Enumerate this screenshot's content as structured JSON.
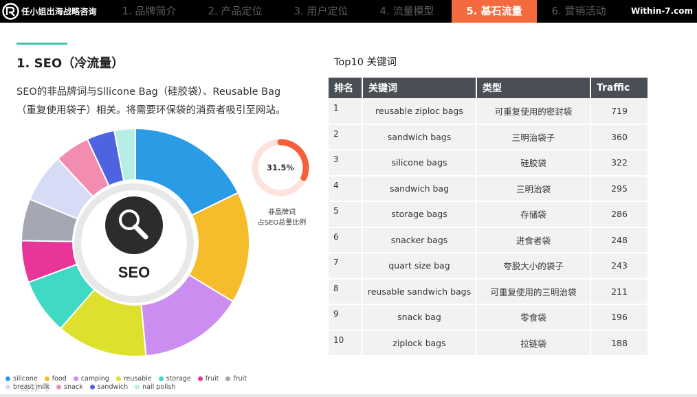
{
  "header": {
    "brand": "任小姐出海战略咨询",
    "site": "Within-7.com",
    "tabs": [
      {
        "label": "1. 品牌简介",
        "active": false
      },
      {
        "label": "2. 产品定位",
        "active": false
      },
      {
        "label": "3. 用户定位",
        "active": false
      },
      {
        "label": "4. 流量模型",
        "active": false
      },
      {
        "label": "5. 基石流量",
        "active": true
      },
      {
        "label": "6. 营销活动",
        "active": false
      }
    ]
  },
  "section": {
    "title": "1. SEO（冷流量）",
    "description": "SEO的非品牌词与Sllicone Bag（硅胶袋）、Reusable Bag（重复使用袋子）相关。将需要环保袋的消费者吸引至网站。"
  },
  "pie_center": {
    "label": "SEO",
    "icon": "search-icon"
  },
  "ring": {
    "value_label": "31.5%",
    "value": 31.5,
    "caption_line1": "非品牌词",
    "caption_line2": "占SEO总量比例",
    "color": "#f4603c",
    "track_color": "#fde3dc"
  },
  "chart_data": [
    {
      "type": "pie",
      "note_colors": [
        "#2b9be6",
        "#f5bc2c",
        "#cc8df0",
        "#dde12e",
        "#3fd9c4",
        "#e8359a",
        "#a5a8b2",
        "#d6dcf6",
        "#f38cb1",
        "#4d63e0",
        "#b6ede6"
      ],
      "values": [
        18,
        16,
        15,
        13,
        8,
        6,
        6,
        7,
        5,
        4,
        3
      ],
      "legend": [
        {
          "label": "silicone",
          "color": "#2b9be6"
        },
        {
          "label": "food",
          "color": "#f5bc2c"
        },
        {
          "label": "camping",
          "color": "#cc8df0"
        },
        {
          "label": "reusable",
          "color": "#dde12e"
        },
        {
          "label": "storage",
          "color": "#3fd9c4"
        },
        {
          "label": "fruit",
          "color": "#e8359a"
        },
        {
          "label": "fruit",
          "color": "#a5a8b2"
        },
        {
          "label": "breast milk",
          "color": "#d6dcf6"
        },
        {
          "label": "snack",
          "color": "#f38cb1"
        },
        {
          "label": "sandwich",
          "color": "#4d63e0"
        },
        {
          "label": "nail polish",
          "color": "#b6ede6"
        }
      ]
    },
    {
      "type": "pie",
      "values": [
        31.5,
        68.5
      ],
      "title": "31.5%"
    }
  ],
  "table": {
    "title": "Top10 关键词",
    "columns": [
      "排名",
      "关键词",
      "类型",
      "Traffic"
    ],
    "rows": [
      {
        "rank": "1",
        "keyword": "reusable ziploc bags",
        "type": "可重复使用的密封袋",
        "traffic": "719"
      },
      {
        "rank": "2",
        "keyword": "sandwich bags",
        "type": "三明治袋子",
        "traffic": "360"
      },
      {
        "rank": "3",
        "keyword": "silicone bags",
        "type": "硅胶袋",
        "traffic": "322"
      },
      {
        "rank": "4",
        "keyword": "sandwich bag",
        "type": "三明治袋",
        "traffic": "295"
      },
      {
        "rank": "5",
        "keyword": "storage bags",
        "type": "存储袋",
        "traffic": "286"
      },
      {
        "rank": "6",
        "keyword": "snacker bags",
        "type": "进食者袋",
        "traffic": "248"
      },
      {
        "rank": "7",
        "keyword": "quart size bag",
        "type": "夸脱大小的袋子",
        "traffic": "243"
      },
      {
        "rank": "8",
        "keyword": "reusable sandwich bags",
        "type": "可重复使用的三明治袋",
        "traffic": "211"
      },
      {
        "rank": "9",
        "keyword": "snack bag",
        "type": "零食袋",
        "traffic": "196"
      },
      {
        "rank": "10",
        "keyword": "ziplock bags",
        "type": "拉链袋",
        "traffic": "188"
      }
    ]
  },
  "watermark": "公众号"
}
